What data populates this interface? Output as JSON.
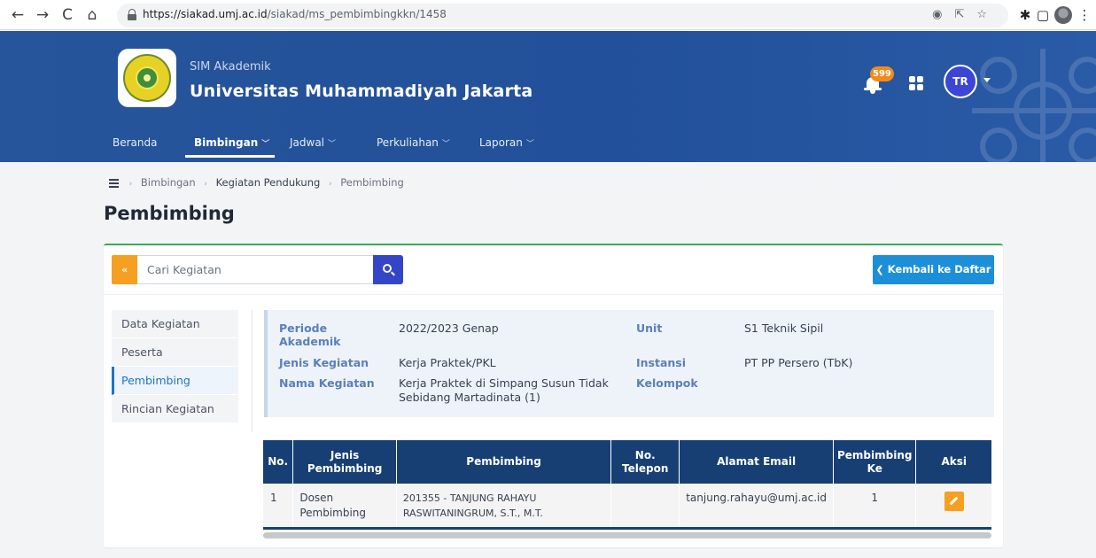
{
  "browser": {
    "url_host": "https://siakad.umj.ac.id",
    "url_path": "/siakad/ms_pembimbingkkn/1458"
  },
  "header": {
    "subtitle": "SIM Akademik",
    "title": "Universitas Muhammadiyah Jakarta",
    "notification_count": "599",
    "user_initials": "TR"
  },
  "menu": [
    {
      "label": "Beranda",
      "has_dropdown": false
    },
    {
      "label": "Bimbingan",
      "has_dropdown": true,
      "active": true
    },
    {
      "label": "Jadwal",
      "has_dropdown": true
    },
    {
      "label": "Perkuliahan",
      "has_dropdown": true
    },
    {
      "label": "Laporan",
      "has_dropdown": true
    }
  ],
  "breadcrumb": [
    "Bimbingan",
    "Kegiatan Pendukung",
    "Pembimbing"
  ],
  "page_title": "Pembimbing",
  "search": {
    "placeholder": "Cari Kegiatan",
    "back_label": "«"
  },
  "return_button": "Kembali ke Daftar",
  "sidenav": [
    {
      "label": "Data Kegiatan",
      "active": false
    },
    {
      "label": "Peserta",
      "active": false
    },
    {
      "label": "Pembimbing",
      "active": true
    },
    {
      "label": "Rincian Kegiatan",
      "active": false
    }
  ],
  "info": {
    "periode_label": "Periode Akademik",
    "periode_value": "2022/2023 Genap",
    "jenis_label": "Jenis Kegiatan",
    "jenis_value": "Kerja Praktek/PKL",
    "nama_label": "Nama Kegiatan",
    "nama_value": "Kerja Praktek di Simpang Susun Tidak Sebidang Martadinata (1)",
    "unit_label": "Unit",
    "unit_value": "S1 Teknik Sipil",
    "instansi_label": "Instansi",
    "instansi_value": "PT PP Persero (TbK)",
    "kelompok_label": "Kelompok",
    "kelompok_value": ""
  },
  "table": {
    "headers": [
      "No.",
      "Jenis Pembimbing",
      "Pembimbing",
      "No. Telepon",
      "Alamat Email",
      "Pembimbing Ke",
      "Aksi"
    ],
    "rows": [
      {
        "no": "1",
        "jenis": "Dosen Pembimbing",
        "pembimbing": "201355 - TANJUNG RAHAYU RASWITANINGRUM, S.T., M.T.",
        "telepon": "",
        "email": "tanjung.rahayu@umj.ac.id",
        "ke": "1"
      }
    ]
  },
  "colors": {
    "header_bg": "#22509a",
    "accent_orange": "#f5a021",
    "table_header": "#173f74",
    "primary_blue": "#1d8fd8",
    "success_green": "#3aa85a"
  }
}
